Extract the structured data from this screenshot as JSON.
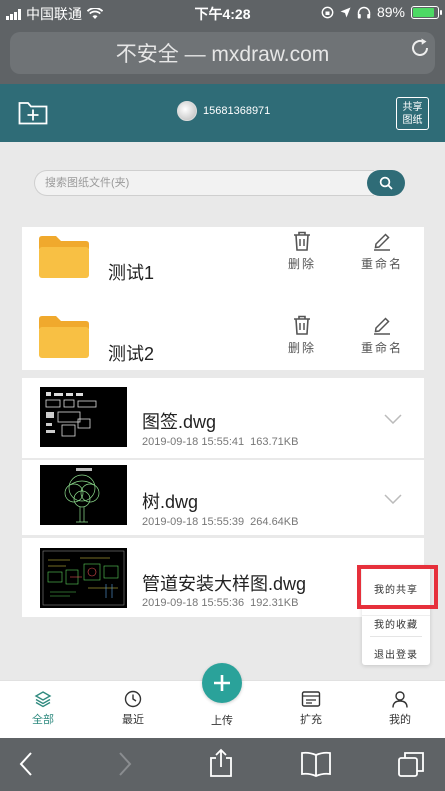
{
  "status_bar": {
    "carrier": "中国联通",
    "time": "下午4:28",
    "battery": "89%",
    "battery_level": 0.89
  },
  "browser": {
    "url_text": "不安全 — mxdraw.com"
  },
  "header": {
    "username": "15681368971",
    "share_button_line1": "共享",
    "share_button_line2": "图纸"
  },
  "search": {
    "placeholder": "搜索图纸文件(夹)"
  },
  "folders": [
    {
      "name": "测试1",
      "delete_label": "删除",
      "rename_label": "重命名"
    },
    {
      "name": "测试2",
      "delete_label": "删除",
      "rename_label": "重命名"
    }
  ],
  "files": [
    {
      "name": "图签.dwg",
      "date": "2019-09-18 15:55:41",
      "size": "163.71KB"
    },
    {
      "name": "树.dwg",
      "date": "2019-09-18 15:55:39",
      "size": "264.64KB"
    },
    {
      "name": "管道安装大样图.dwg",
      "date": "2019-09-18 15:55:36",
      "size": "192.31KB"
    }
  ],
  "popup_menu": {
    "items": [
      "我的共享",
      "我的收藏",
      "退出登录"
    ]
  },
  "tabs": [
    {
      "label": "全部",
      "icon": "layers-icon"
    },
    {
      "label": "最近",
      "icon": "clock-icon"
    },
    {
      "label": "上传",
      "icon": "plus-icon"
    },
    {
      "label": "扩充",
      "icon": "card-icon"
    },
    {
      "label": "我的",
      "icon": "person-icon"
    }
  ],
  "colors": {
    "brand": "#2f6c77",
    "accent": "#2aa29a",
    "folder": "#f5b335",
    "highlight": "#e6303b"
  }
}
